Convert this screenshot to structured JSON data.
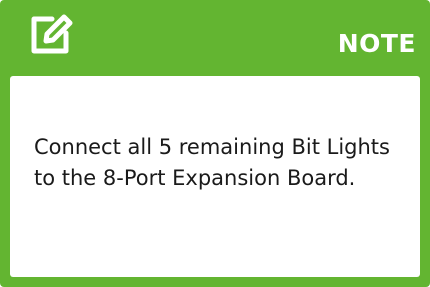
{
  "note": {
    "title": "NOTE",
    "icon": "edit-note-icon",
    "body": "Connect all 5 remaining Bit Lights to the 8-Port Expansion Board."
  },
  "colors": {
    "accent": "#63b531",
    "header_text": "#ffffff",
    "body_text": "#1a1a1a",
    "body_bg": "#ffffff"
  }
}
